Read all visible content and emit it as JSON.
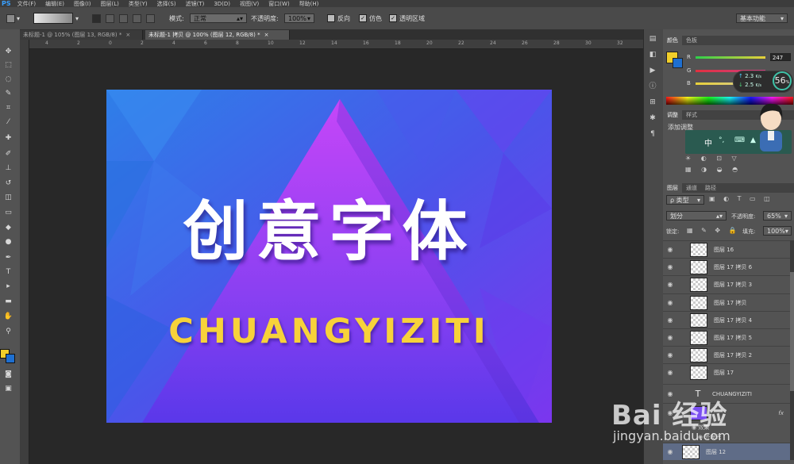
{
  "app": {
    "logo": "PS",
    "menu": [
      "文件(F)",
      "编辑(E)",
      "图像(I)",
      "图层(L)",
      "类型(Y)",
      "选择(S)",
      "滤镜(T)",
      "3D(D)",
      "视图(V)",
      "窗口(W)",
      "帮助(H)"
    ]
  },
  "options": {
    "mode_label": "模式:",
    "mode_value": "正常",
    "opacity_label": "不透明度:",
    "opacity_value": "100%",
    "reverse_label": "反向",
    "dither_label": "仿色",
    "transparency_label": "透明区域",
    "workspace": "基本功能"
  },
  "tabs": [
    {
      "label": "未标题-1 @ 105% (图层 13, RGB/8) *",
      "close": "×"
    },
    {
      "label": "未标题-1 拷贝 @ 100% (图层 12, RGB/8) *",
      "close": "×"
    }
  ],
  "ruler_top": [
    "4",
    "2",
    "0",
    "2",
    "4",
    "6",
    "8",
    "10",
    "12",
    "14",
    "16",
    "18",
    "20",
    "22",
    "24",
    "26",
    "28",
    "30",
    "32"
  ],
  "canvas": {
    "headline": "创意字体",
    "subline": "CHUANGYIZITI",
    "colors": {
      "bg_start": "#2f7de6",
      "bg_end": "#7a35ee",
      "triangle": "#c445f7",
      "headline": "#ffffff",
      "subline": "#f7d23a"
    }
  },
  "color_panel": {
    "tabs": [
      "颜色",
      "色板"
    ],
    "r_label": "R",
    "g_label": "G",
    "b_label": "B",
    "r_value": "247",
    "net_up": "2.3",
    "net_up_unit": "K/s",
    "net_down": "2.5",
    "net_down_unit": "K/s",
    "cpu": "56",
    "cpu_unit": "%",
    "fg_color": "#f2cf2a",
    "bg_color": "#1e6fd0"
  },
  "adjust_panel": {
    "tabs": [
      "调整",
      "样式"
    ],
    "add_label": "添加调整",
    "ime_label": "中"
  },
  "layers_panel": {
    "tabs": [
      "图层",
      "通道",
      "路径"
    ],
    "kind_label": "ρ 类型",
    "blend_value": "划分",
    "opacity_label": "不透明度:",
    "opacity_value": "65%",
    "lock_label": "锁定:",
    "fill_label": "填充:",
    "fill_value": "100%",
    "layers": [
      {
        "name": "图层 16"
      },
      {
        "name": "图层 17 拷贝 6"
      },
      {
        "name": "图层 17 拷贝 3"
      },
      {
        "name": "图层 17 拷贝"
      },
      {
        "name": "图层 17 拷贝 4"
      },
      {
        "name": "图层 17 拷贝 5"
      },
      {
        "name": "图层 17 拷贝 2"
      },
      {
        "name": "图层 17"
      }
    ],
    "text_layer": "CHUANGYIZITI",
    "fx_label": "fx",
    "effects_label": "效果",
    "effect_item": "外发光",
    "selected_layer": "图层 12"
  },
  "watermark": {
    "brand": "Bai 经验",
    "url": "jingyan.baidu.com"
  }
}
